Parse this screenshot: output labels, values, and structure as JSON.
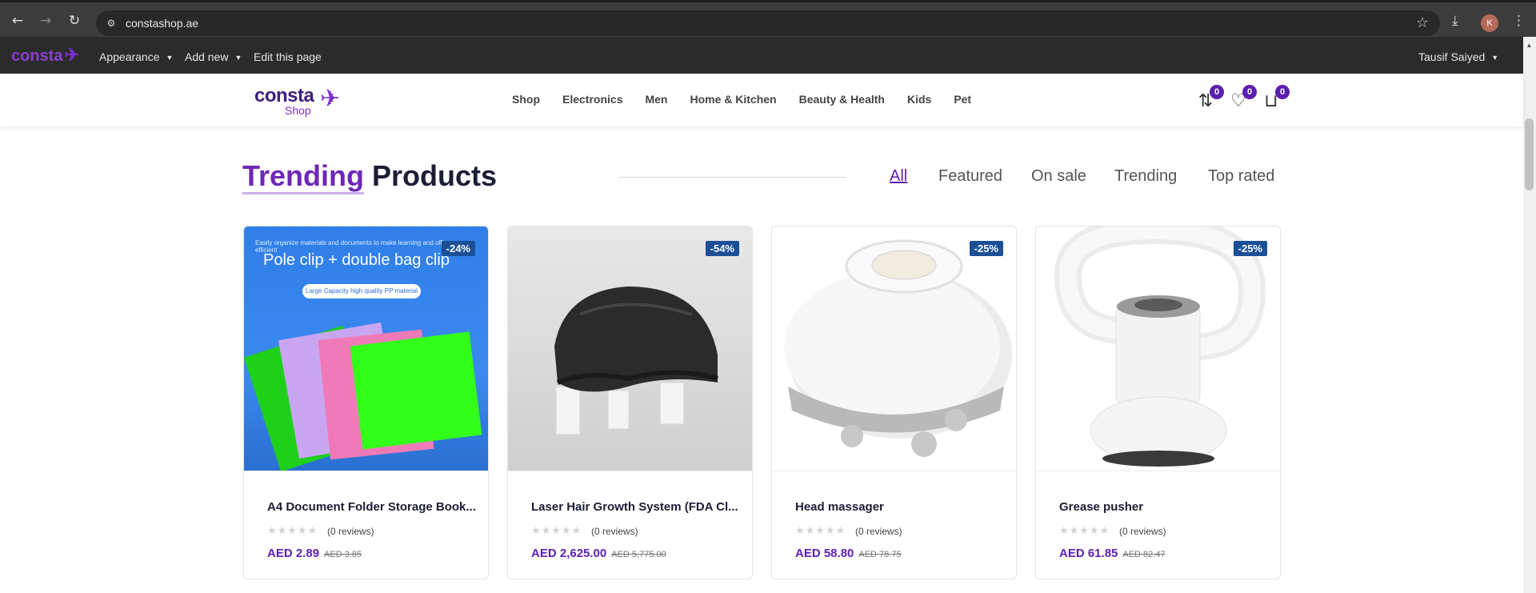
{
  "browser": {
    "url": "constashop.ae",
    "profile_initial": "K"
  },
  "adminbar": {
    "logo": "consta",
    "items": [
      "Appearance",
      "Add new",
      "Edit this page"
    ],
    "user": "Tausif Saiyed"
  },
  "header": {
    "brand_word": "consta",
    "brand_sub": "Shop",
    "nav": [
      "Shop",
      "Electronics",
      "Men",
      "Home & Kitchen",
      "Beauty & Health",
      "Kids",
      "Pet"
    ],
    "compare_count": "0",
    "wishlist_count": "0",
    "cart_count": "0"
  },
  "section": {
    "title_accent": "Trending",
    "title_rest": " Products",
    "filters": [
      "All",
      "Featured",
      "On sale",
      "Trending",
      "Top rated"
    ],
    "active_filter": "All"
  },
  "products": [
    {
      "name": "A4 Document Folder Storage Book...",
      "badge": "-24%",
      "stars": "★★★★★",
      "reviews": "(0 reviews)",
      "price": "AED 2.89",
      "old_price": "AED 3.85",
      "image_text_small": "Easily organize materials and documents to make learning and office more efficient",
      "image_text_title": "Pole clip + double bag clip",
      "image_text_pill": "Large Capacity high quality PP material"
    },
    {
      "name": "Laser Hair Growth System (FDA Cl...",
      "badge": "-54%",
      "stars": "★★★★★",
      "reviews": "(0 reviews)",
      "price": "AED 2,625.00",
      "old_price": "AED 5,775.00"
    },
    {
      "name": "Head massager",
      "badge": "-25%",
      "stars": "★★★★★",
      "reviews": "(0 reviews)",
      "price": "AED 58.80",
      "old_price": "AED 78.75"
    },
    {
      "name": "Grease pusher",
      "badge": "-25%",
      "stars": "★★★★★",
      "reviews": "(0 reviews)",
      "price": "AED 61.85",
      "old_price": "AED 82.47"
    }
  ]
}
